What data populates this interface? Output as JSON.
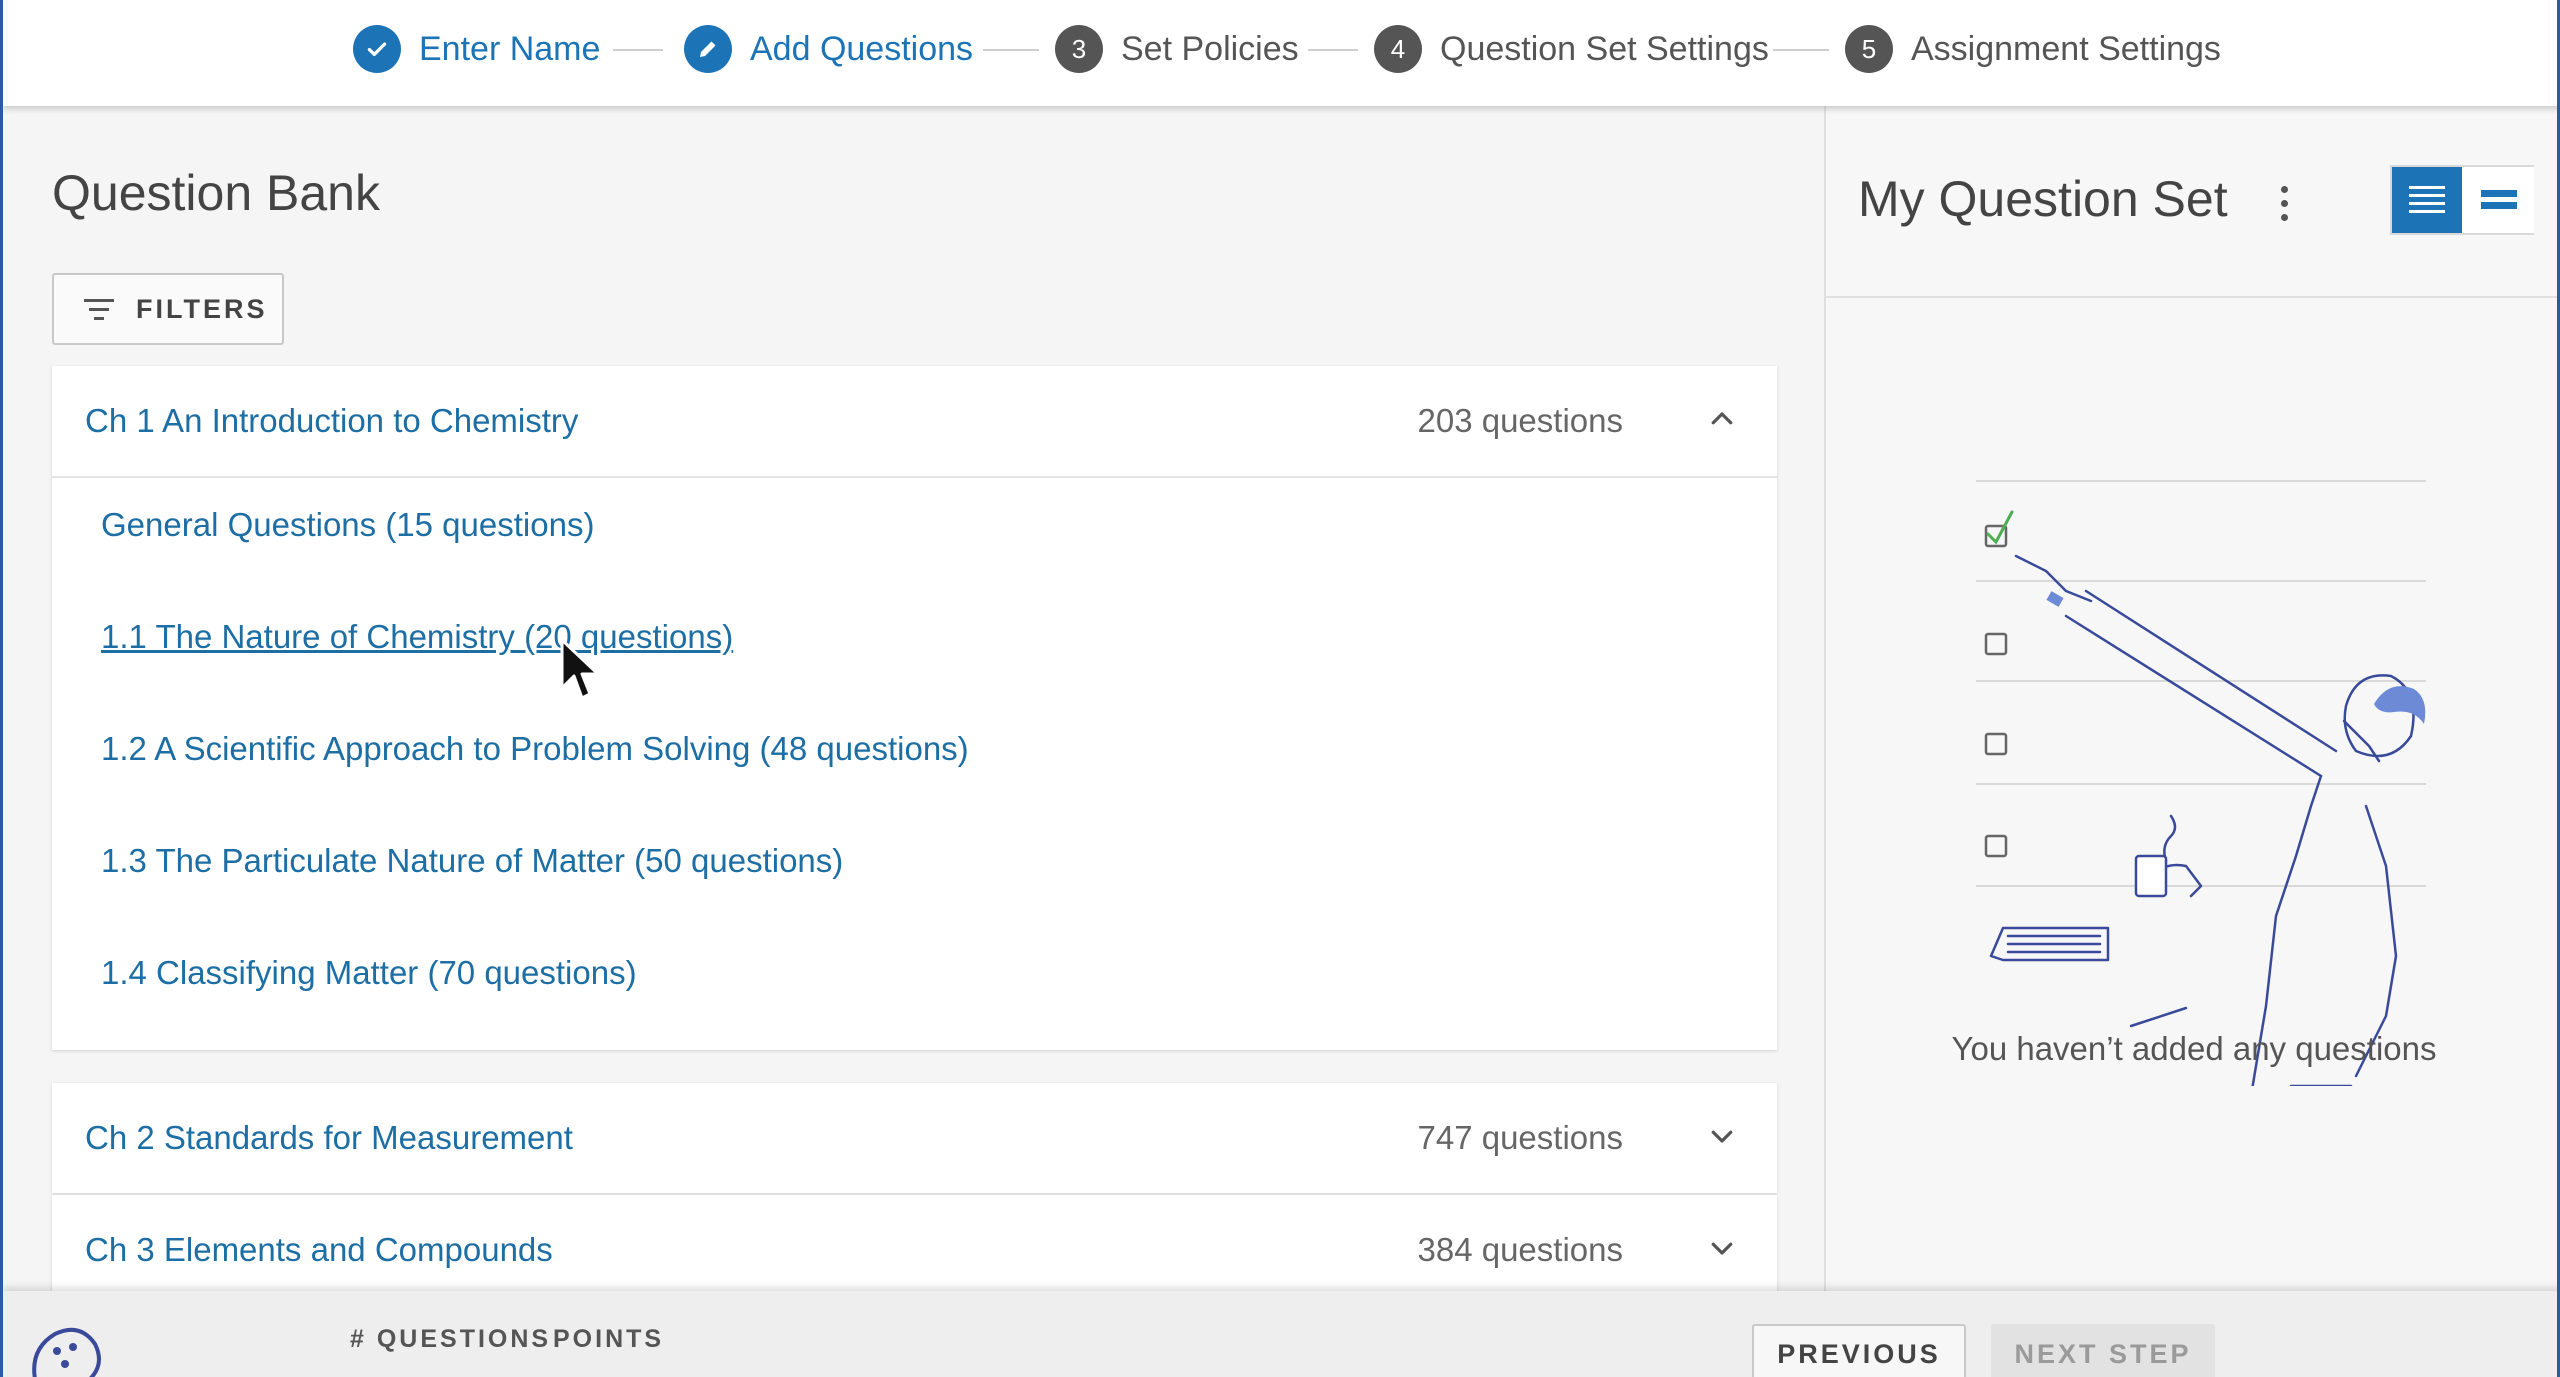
{
  "stepper": {
    "steps": [
      {
        "label": "Enter Name",
        "status": "done"
      },
      {
        "label": "Add Questions",
        "status": "current"
      },
      {
        "label": "Set Policies",
        "number": "3",
        "status": "todo"
      },
      {
        "label": "Question Set Settings",
        "number": "4",
        "status": "todo"
      },
      {
        "label": "Assignment Settings",
        "number": "5",
        "status": "todo"
      }
    ]
  },
  "question_bank": {
    "title": "Question Bank",
    "filters_label": "FILTERS",
    "chapters": [
      {
        "title": "Ch 1 An Introduction to Chemistry",
        "count": "203 questions",
        "expanded": true,
        "sections": [
          "General Questions (15 questions)",
          "1.1 The Nature of Chemistry (20 questions)",
          "1.2 A Scientific Approach to Problem Solving (48 questions)",
          "1.3 The Particulate Nature of Matter (50 questions)",
          "1.4 Classifying Matter (70 questions)"
        ]
      },
      {
        "title": "Ch 2 Standards for Measurement",
        "count": "747 questions",
        "expanded": false
      },
      {
        "title": "Ch 3 Elements and Compounds",
        "count": "384 questions",
        "expanded": false
      }
    ]
  },
  "question_set": {
    "title": "My Question Set",
    "empty_message": "You haven’t added any questions",
    "view_mode": "list-detailed"
  },
  "footer": {
    "questions_label": "# QUESTIONS",
    "points_label": "POINTS",
    "previous_label": "PREVIOUS",
    "next_label": "NEXT STEP"
  },
  "colors": {
    "accent": "#1c74b6",
    "link": "#1c6ea4",
    "step_inactive": "#555555"
  }
}
